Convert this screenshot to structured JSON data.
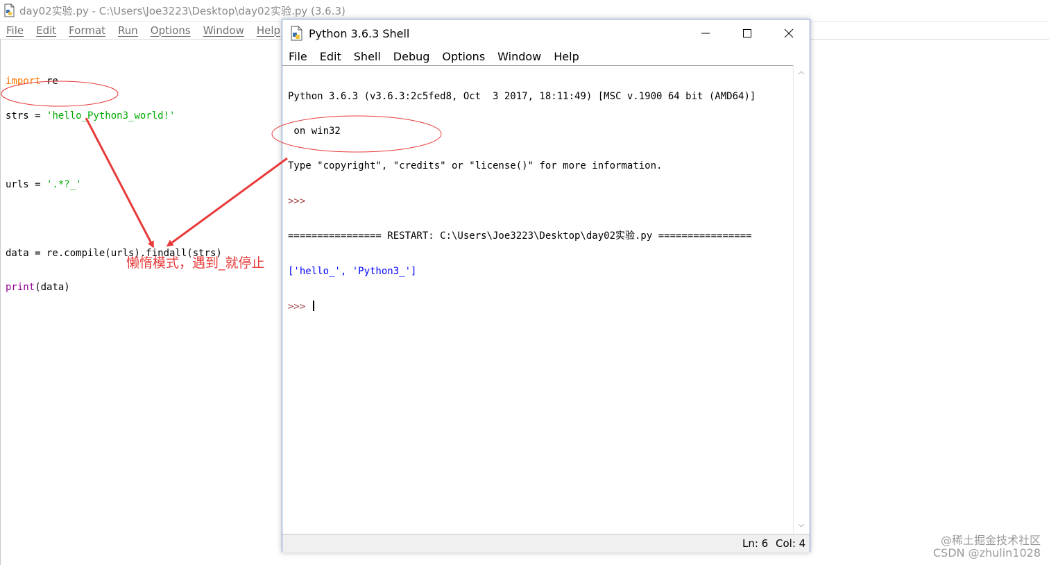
{
  "editor": {
    "title": "day02实验.py - C:\\Users\\Joe3223\\Desktop\\day02实验.py (3.6.3)",
    "menu": [
      "File",
      "Edit",
      "Format",
      "Run",
      "Options",
      "Window",
      "Help"
    ],
    "code": {
      "line1_kw": "import",
      "line1_rest": " re",
      "line2_pre": "strs = ",
      "line2_str": "'hello_Python3_world!'",
      "line4_pre": "urls = ",
      "line4_str": "'.*?_'",
      "line6": "data = re.compile(urls).findall(strs)",
      "line7_kw": "print",
      "line7_rest": "(data)"
    }
  },
  "annotation": {
    "text": "懒惰模式，遇到_就停止",
    "color": "#e83a3a"
  },
  "shell": {
    "title": "Python 3.6.3 Shell",
    "menu": [
      "File",
      "Edit",
      "Shell",
      "Debug",
      "Options",
      "Window",
      "Help"
    ],
    "lines": {
      "banner1": "Python 3.6.3 (v3.6.3:2c5fed8, Oct  3 2017, 18:11:49) [MSC v.1900 64 bit (AMD64)]",
      "banner2": " on win32",
      "banner3": "Type \"copyright\", \"credits\" or \"license()\" for more information.",
      "prompt1": ">>> ",
      "restart": "================ RESTART: C:\\Users\\Joe3223\\Desktop\\day02实验.py ================",
      "output": "['hello_', 'Python3_']",
      "prompt2": ">>> "
    },
    "status": {
      "ln": "Ln: 6",
      "col": "Col: 4"
    }
  },
  "watermark": {
    "line1": "@稀土掘金技术社区",
    "line2": "CSDN @zhulin1028"
  },
  "icons": {
    "app": "python-file-icon",
    "minimize": "minimize-icon",
    "maximize": "maximize-icon",
    "close": "close-icon"
  }
}
